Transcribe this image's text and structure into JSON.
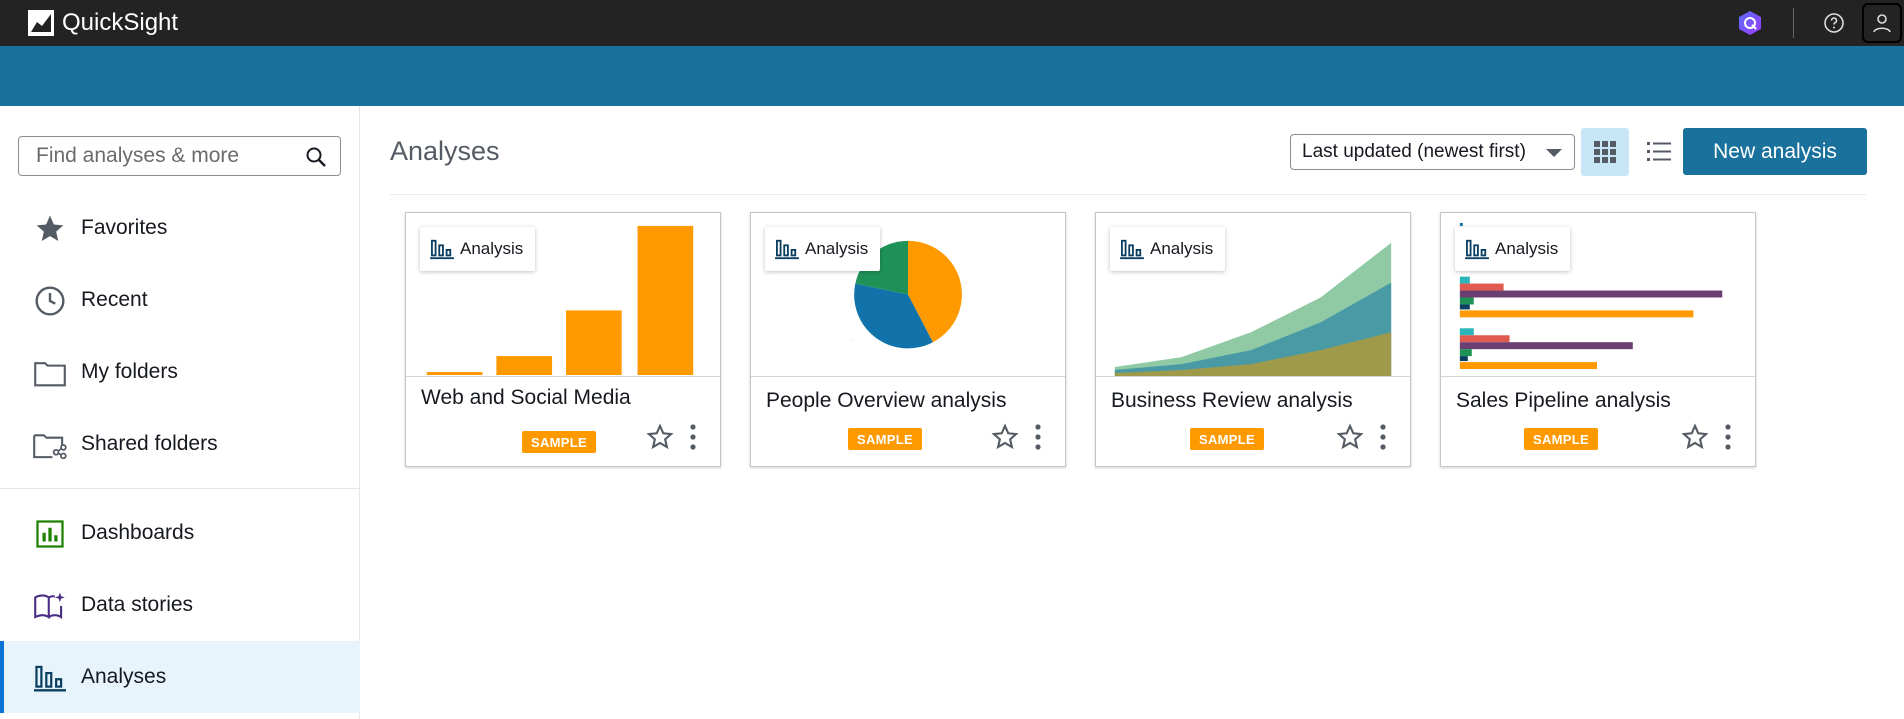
{
  "app": {
    "title": "QuickSight"
  },
  "search": {
    "placeholder": "Find analyses & more"
  },
  "sidebar": {
    "items": [
      {
        "label": "Favorites",
        "icon": "star-icon"
      },
      {
        "label": "Recent",
        "icon": "clock-icon"
      },
      {
        "label": "My folders",
        "icon": "folder-icon"
      },
      {
        "label": "Shared folders",
        "icon": "shared-folder-icon"
      },
      {
        "label": "Dashboards",
        "icon": "dashboard-icon"
      },
      {
        "label": "Data stories",
        "icon": "book-sparkle-icon"
      },
      {
        "label": "Analyses",
        "icon": "bar-chart-icon",
        "active": true
      }
    ]
  },
  "main": {
    "title": "Analyses",
    "sort": {
      "selected": "Last updated (newest first)"
    },
    "new_button": "New analysis",
    "cards": [
      {
        "type_label": "Analysis",
        "name": "Web and Social Media",
        "badge": "SAMPLE"
      },
      {
        "type_label": "Analysis",
        "name": "People Overview analysis",
        "badge": "SAMPLE"
      },
      {
        "type_label": "Analysis",
        "name": "Business Review analysis",
        "badge": "SAMPLE"
      },
      {
        "type_label": "Analysis",
        "name": "Sales Pipeline analysis",
        "badge": "SAMPLE"
      }
    ]
  },
  "colors": {
    "topbar": "#232323",
    "banner": "#19719c",
    "accent": "#19719c",
    "sample_badge": "#ff9900"
  }
}
